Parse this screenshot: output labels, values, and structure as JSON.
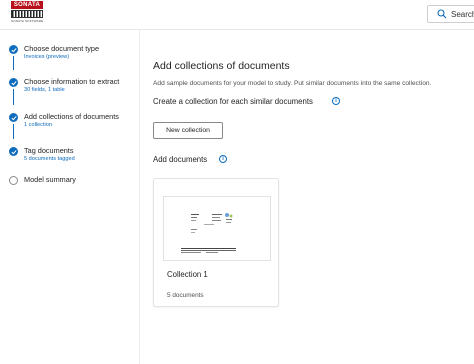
{
  "brand": {
    "name": "SONATA",
    "subtitle": "SONATA SOFTWARE"
  },
  "header": {
    "search_label": "Search"
  },
  "steps": [
    {
      "title": "Choose document type",
      "subtitle": "Invoices (preview)",
      "status": "complete"
    },
    {
      "title": "Choose information to extract",
      "subtitle": "30 fields, 1 table",
      "status": "complete"
    },
    {
      "title": "Add collections of documents",
      "subtitle": "1 collection",
      "status": "complete"
    },
    {
      "title": "Tag documents",
      "subtitle": "5 documents tagged",
      "status": "complete"
    },
    {
      "title": "Model summary",
      "subtitle": "",
      "status": "pending"
    }
  ],
  "main": {
    "title": "Add collections of documents",
    "description": "Add sample documents for your model to study. Put similar documents into the same collection.",
    "collection_heading": "Create a collection for each similar documents",
    "new_collection_label": "New collection",
    "add_documents_heading": "Add documents",
    "collections": [
      {
        "name": "Collection 1",
        "count_label": "5 documents"
      }
    ]
  },
  "colors": {
    "accent": "#0f6cbd",
    "brand_red": "#b8101a"
  }
}
